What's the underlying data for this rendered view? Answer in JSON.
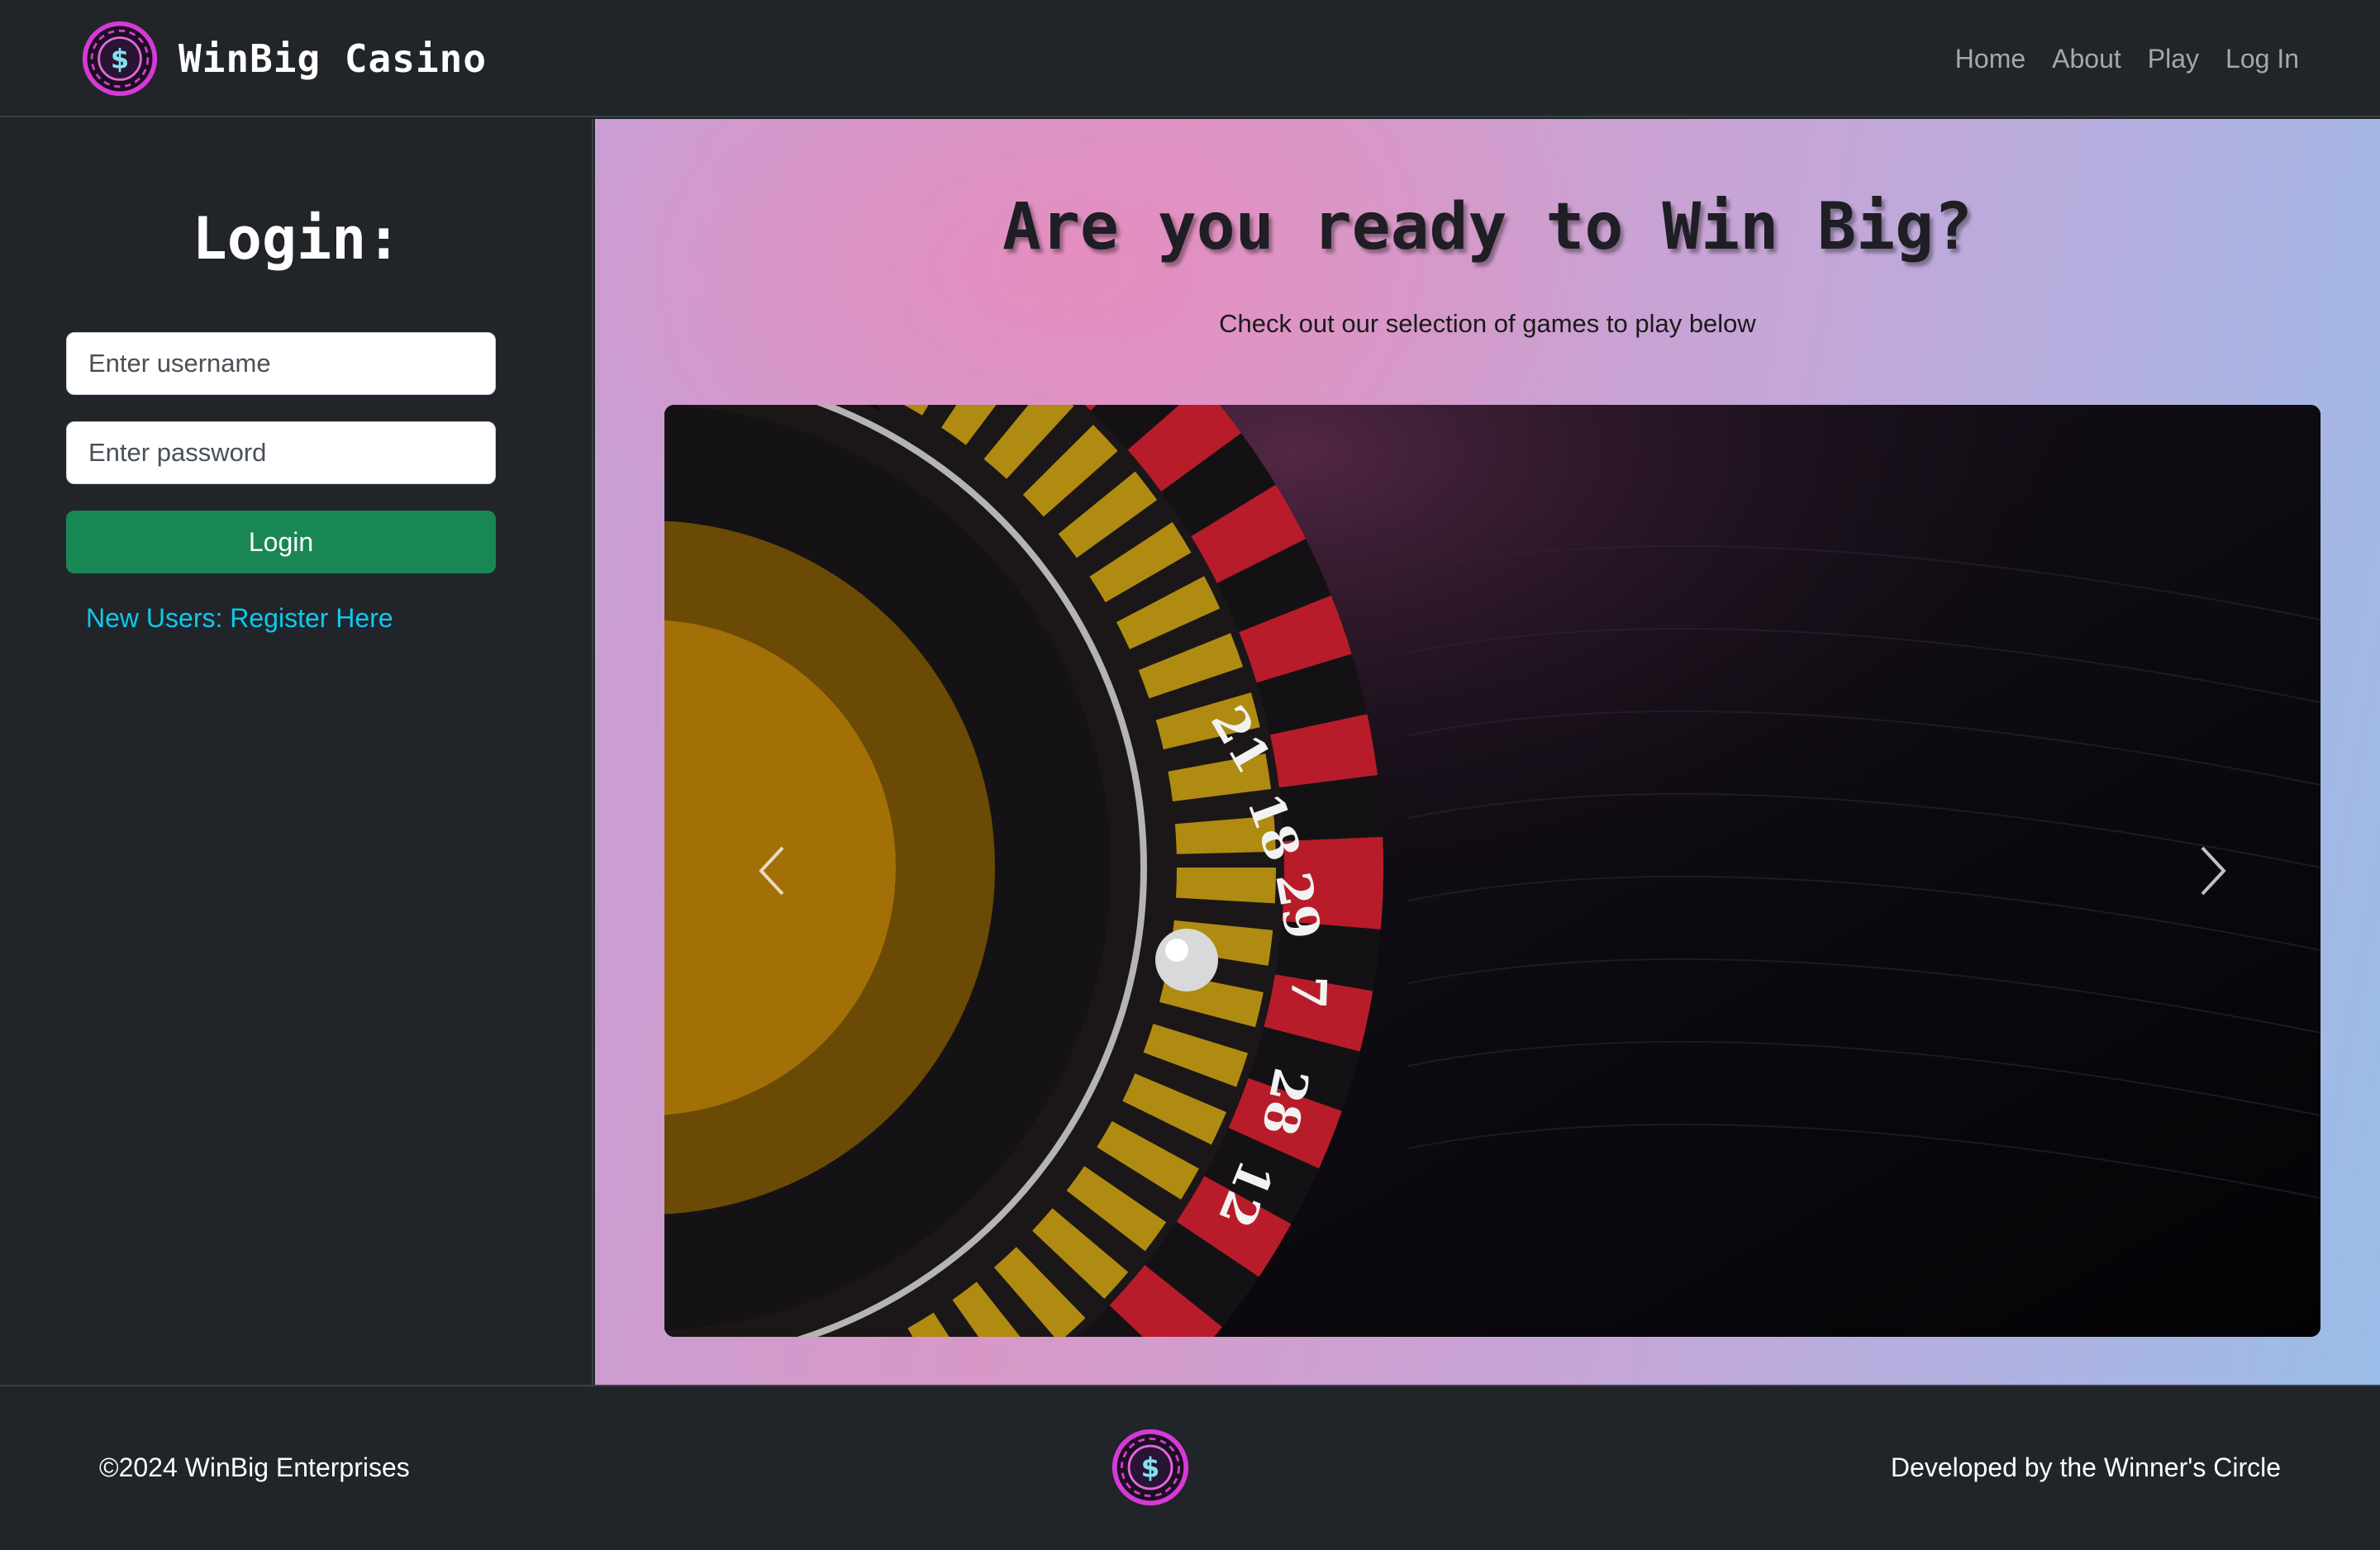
{
  "navbar": {
    "brand": "WinBig Casino",
    "links": [
      "Home",
      "About",
      "Play",
      "Log In"
    ]
  },
  "sidebar": {
    "title": "Login:",
    "username_placeholder": "Enter username",
    "password_placeholder": "Enter password",
    "login_button": "Login",
    "register_link": "New Users: Register Here"
  },
  "main": {
    "title": "Are you ready to Win Big?",
    "subtitle": "Check out our selection of games to play below",
    "carousel": {
      "wheel_numbers": [
        "21",
        "18",
        "29",
        "7",
        "28",
        "12"
      ]
    }
  },
  "footer": {
    "copyright": "©2024 WinBig Enterprises",
    "credit": "Developed by the Winner's Circle"
  },
  "colors": {
    "dark": "#212529",
    "success": "#198754",
    "link": "#0dcaf0",
    "chip_ring": "#d63ad6",
    "chip_symbol": "#7fe3f0"
  },
  "icons": [
    "dollar-chip-icon",
    "chevron-left-icon",
    "chevron-right-icon"
  ]
}
